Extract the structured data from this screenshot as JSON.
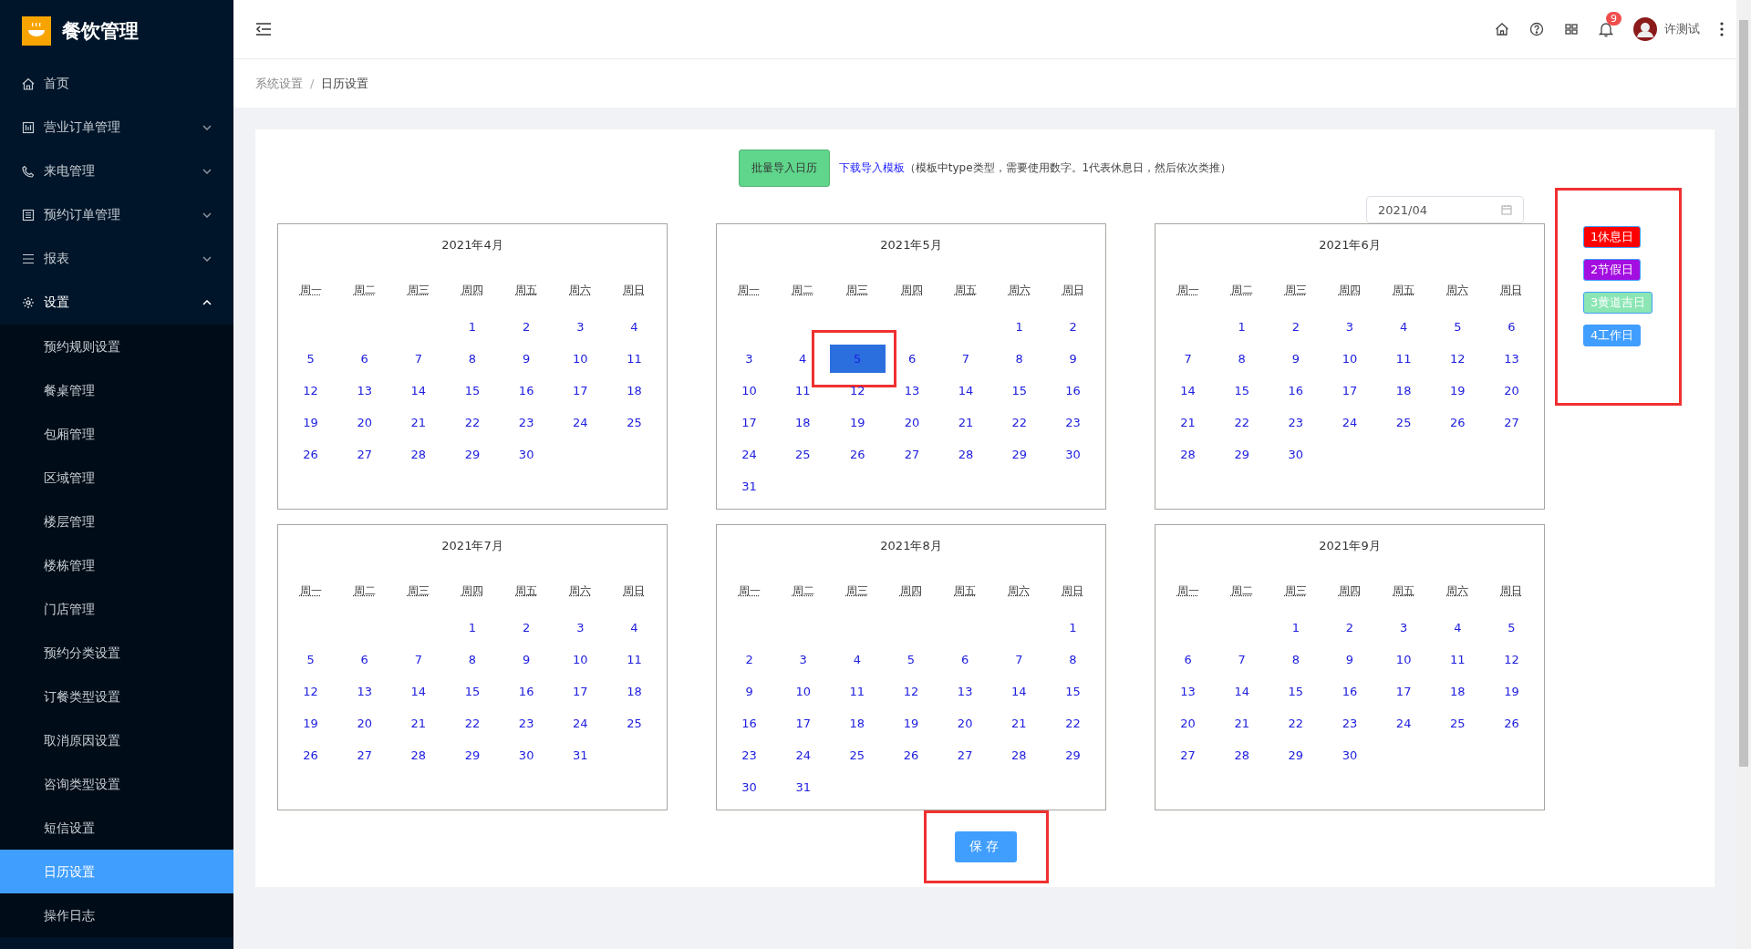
{
  "app": {
    "title": "餐饮管理"
  },
  "sidebar": {
    "items": [
      {
        "label": "首页",
        "selected": false
      },
      {
        "label": "营业订单管理",
        "expanded": false,
        "selected": false
      },
      {
        "label": "来电管理",
        "expanded": false,
        "selected": false
      },
      {
        "label": "预约订单管理",
        "expanded": false,
        "selected": false
      },
      {
        "label": "报表",
        "expanded": false,
        "selected": false
      },
      {
        "label": "设置",
        "expanded": true,
        "selected": false,
        "children": [
          {
            "label": "预约规则设置",
            "selected": false
          },
          {
            "label": "餐桌管理",
            "selected": false
          },
          {
            "label": "包厢管理",
            "selected": false
          },
          {
            "label": "区域管理",
            "selected": false
          },
          {
            "label": "楼层管理",
            "selected": false
          },
          {
            "label": "楼栋管理",
            "selected": false
          },
          {
            "label": "门店管理",
            "selected": false
          },
          {
            "label": "预约分类设置",
            "selected": false
          },
          {
            "label": "订餐类型设置",
            "selected": false
          },
          {
            "label": "取消原因设置",
            "selected": false
          },
          {
            "label": "咨询类型设置",
            "selected": false
          },
          {
            "label": "短信设置",
            "selected": false
          },
          {
            "label": "日历设置",
            "selected": true
          },
          {
            "label": "操作日志",
            "selected": false
          }
        ]
      }
    ]
  },
  "header": {
    "notifications": "9",
    "user": "许测试"
  },
  "breadcrumb": {
    "separator": "/",
    "items": [
      "系统设置",
      "日历设置"
    ]
  },
  "toolbar": {
    "import_button": "批量导入日历",
    "template_link": "下载导入模板",
    "hint": "（模板中type类型，需要使用数字。1代表休息日，然后依次类推）"
  },
  "month_picker": {
    "value": "2021/04"
  },
  "months": [
    {
      "title": "2021年4月",
      "weekdays": [
        "周一",
        "周二",
        "周三",
        "周四",
        "周五",
        "周六",
        "周日"
      ],
      "weeks": [
        [
          "1",
          "2",
          "3",
          "4"
        ],
        [
          "5",
          "6",
          "7",
          "8",
          "9",
          "10",
          "11"
        ],
        [
          "12",
          "13",
          "14",
          "15",
          "16",
          "17",
          "18"
        ],
        [
          "19",
          "20",
          "21",
          "22",
          "23",
          "24",
          "25"
        ],
        [
          "26",
          "27",
          "28",
          "29",
          "30"
        ]
      ]
    },
    {
      "title": "2021年5月",
      "weekdays": [
        "周一",
        "周二",
        "周三",
        "周四",
        "周五",
        "周六",
        "周日"
      ],
      "weeks": [
        [
          "1",
          "2"
        ],
        [
          "3",
          "4",
          {
            "day": "5",
            "selected": true
          },
          "6",
          "7",
          "8",
          "9"
        ],
        [
          "10",
          "11",
          "12",
          "13",
          "14",
          "15",
          "16"
        ],
        [
          "17",
          "18",
          "19",
          "20",
          "21",
          "22",
          "23"
        ],
        [
          "24",
          "25",
          "26",
          "27",
          "28",
          "29",
          "30"
        ],
        [
          "31"
        ]
      ]
    },
    {
      "title": "2021年6月",
      "weekdays": [
        "周一",
        "周二",
        "周三",
        "周四",
        "周五",
        "周六",
        "周日"
      ],
      "weeks": [
        [
          "1",
          "2",
          "3",
          "4",
          "5",
          "6"
        ],
        [
          "7",
          "8",
          "9",
          "10",
          "11",
          "12",
          "13"
        ],
        [
          "14",
          "15",
          "16",
          "17",
          "18",
          "19",
          "20"
        ],
        [
          "21",
          "22",
          "23",
          "24",
          "25",
          "26",
          "27"
        ],
        [
          "28",
          "29",
          "30"
        ]
      ]
    },
    {
      "title": "2021年7月",
      "weekdays": [
        "周一",
        "周二",
        "周三",
        "周四",
        "周五",
        "周六",
        "周日"
      ],
      "weeks": [
        [
          "1",
          "2",
          "3",
          "4"
        ],
        [
          "5",
          "6",
          "7",
          "8",
          "9",
          "10",
          "11"
        ],
        [
          "12",
          "13",
          "14",
          "15",
          "16",
          "17",
          "18"
        ],
        [
          "19",
          "20",
          "21",
          "22",
          "23",
          "24",
          "25"
        ],
        [
          "26",
          "27",
          "28",
          "29",
          "30",
          "31"
        ]
      ]
    },
    {
      "title": "2021年8月",
      "weekdays": [
        "周一",
        "周二",
        "周三",
        "周四",
        "周五",
        "周六",
        "周日"
      ],
      "weeks": [
        [
          "1"
        ],
        [
          "2",
          "3",
          "4",
          "5",
          "6",
          "7",
          "8"
        ],
        [
          "9",
          "10",
          "11",
          "12",
          "13",
          "14",
          "15"
        ],
        [
          "16",
          "17",
          "18",
          "19",
          "20",
          "21",
          "22"
        ],
        [
          "23",
          "24",
          "25",
          "26",
          "27",
          "28",
          "29"
        ],
        [
          "30",
          "31"
        ]
      ]
    },
    {
      "title": "2021年9月",
      "weekdays": [
        "周一",
        "周二",
        "周三",
        "周四",
        "周五",
        "周六",
        "周日"
      ],
      "weeks": [
        [
          "1",
          "2",
          "3",
          "4",
          "5"
        ],
        [
          "6",
          "7",
          "8",
          "9",
          "10",
          "11",
          "12"
        ],
        [
          "13",
          "14",
          "15",
          "16",
          "17",
          "18",
          "19"
        ],
        [
          "20",
          "21",
          "22",
          "23",
          "24",
          "25",
          "26"
        ],
        [
          "27",
          "28",
          "29",
          "30"
        ]
      ]
    }
  ],
  "legend": [
    {
      "label": "1休息日",
      "color": "#ff0000"
    },
    {
      "label": "2节假日",
      "color": "#a30fe0"
    },
    {
      "label": "3黄道吉日",
      "color": "#8be6b4"
    },
    {
      "label": "4工作日",
      "color": "#409eff"
    }
  ],
  "save_button": "保存"
}
